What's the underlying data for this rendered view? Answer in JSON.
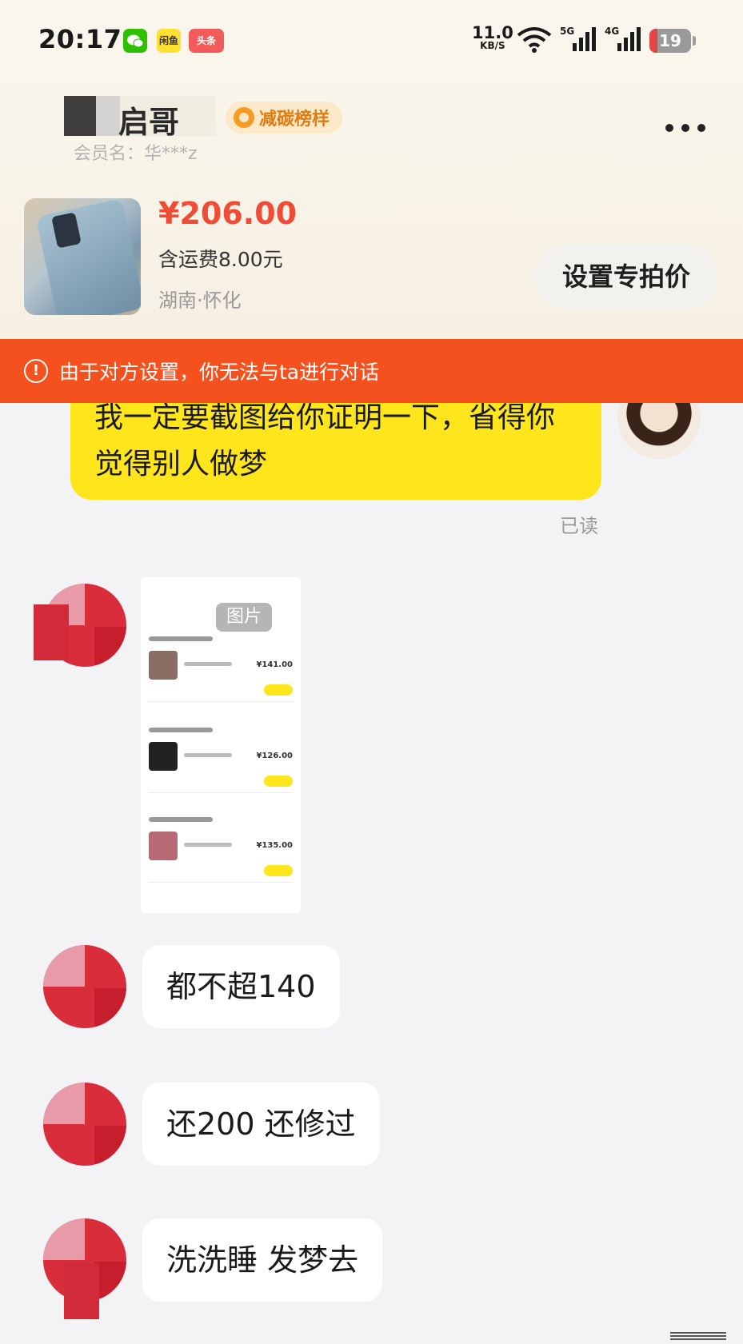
{
  "status_bar": {
    "time": "20:17",
    "apps": [
      "wechat-icon",
      "xianyu-icon",
      "toutiao-icon"
    ],
    "toutiao_label": "头条",
    "xianyu_label": "闲鱼",
    "net_speed": "11.0",
    "net_unit": "KB/S",
    "signal_1": "5G",
    "signal_2": "4G",
    "battery": "19",
    "battery_level": 0.19
  },
  "header": {
    "seller_name": "启哥",
    "member_label": "会员名：华***z",
    "badge": "减碳榜样"
  },
  "product": {
    "price": "¥206.00",
    "shipping": "含运费8.00元",
    "location": "湖南·怀化",
    "special_price_button": "设置专拍价"
  },
  "warning": {
    "text": "由于对方设置，你无法与ta进行对话"
  },
  "messages": {
    "outgoing_1": "我一定要截图给你证明一下，省得你觉得别人做梦",
    "read_status": "已读",
    "image_label": "图片",
    "mini_prices": [
      "¥141.00",
      "¥126.00",
      "¥135.00"
    ],
    "incoming_1": "都不超140",
    "incoming_2": "还200   还修过",
    "incoming_3": "洗洗睡  发梦去"
  },
  "colors": {
    "price": "#ef4b37",
    "warning_bar": "#f4511e",
    "my_bubble": "#ffe51c",
    "badge_text": "#e07c12"
  }
}
